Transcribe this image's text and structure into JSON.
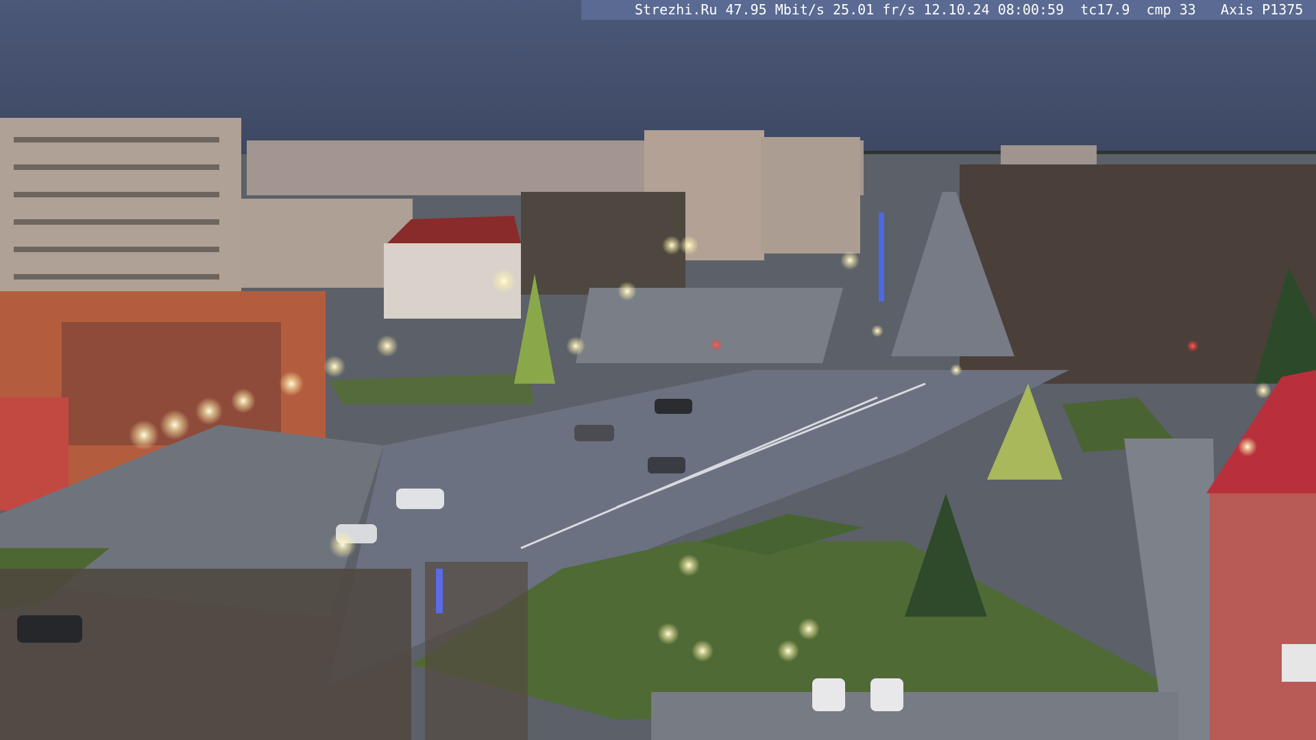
{
  "camera_overlay": {
    "text": "Strezhi.Ru 47.95 Mbit/s 25.01 fr/s 12.10.24 08:00:59  tc17.9  cmp 33   Axis P1375",
    "background": "#5a6a92",
    "color": "#ffffff"
  },
  "scene": {
    "description_kind": "webcam-street-view",
    "colors": {
      "sky_top": "#4a5677",
      "sky_bottom": "#3f4a66",
      "road": "#6b7180",
      "grass": "#4f6a35",
      "pavement": "#80848e",
      "building_light": "#b8a79a",
      "building_red": "#c04a45",
      "lamp_glow": "#fff6c8"
    }
  }
}
